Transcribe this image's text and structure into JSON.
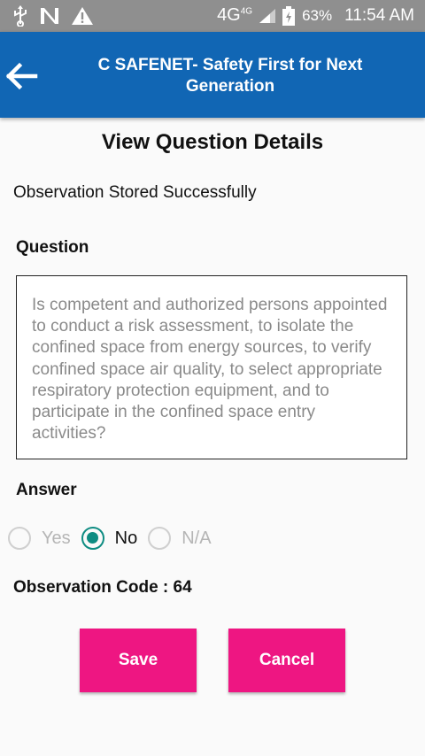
{
  "status_bar": {
    "network": "4G",
    "network_sup": "4G",
    "battery": "63%",
    "time": "11:54 AM",
    "icons": [
      "usb-icon",
      "no-sim-icon",
      "warning-icon",
      "signal-icon",
      "battery-icon"
    ]
  },
  "app_bar": {
    "title": "C SAFENET- Safety First for Next Generation",
    "back_icon": "arrow-left-icon",
    "color": "#1166b4"
  },
  "page": {
    "title": "View Question Details",
    "status_message": "Observation Stored Successfully",
    "question_label": "Question",
    "question_text": "Is competent and authorized persons appointed to conduct a risk assessment, to isolate the confined space from energy sources, to verify confined space air quality, to select appropriate respiratory protection equipment, and to participate in the confined space entry activities?",
    "answer_label": "Answer",
    "answer_options": [
      {
        "label": "Yes",
        "selected": false
      },
      {
        "label": "No",
        "selected": true
      },
      {
        "label": "N/A",
        "selected": false
      }
    ],
    "observation_code": "Observation Code : 64"
  },
  "buttons": {
    "save_label": "Save",
    "cancel_label": "Cancel",
    "color": "#ee1682"
  }
}
